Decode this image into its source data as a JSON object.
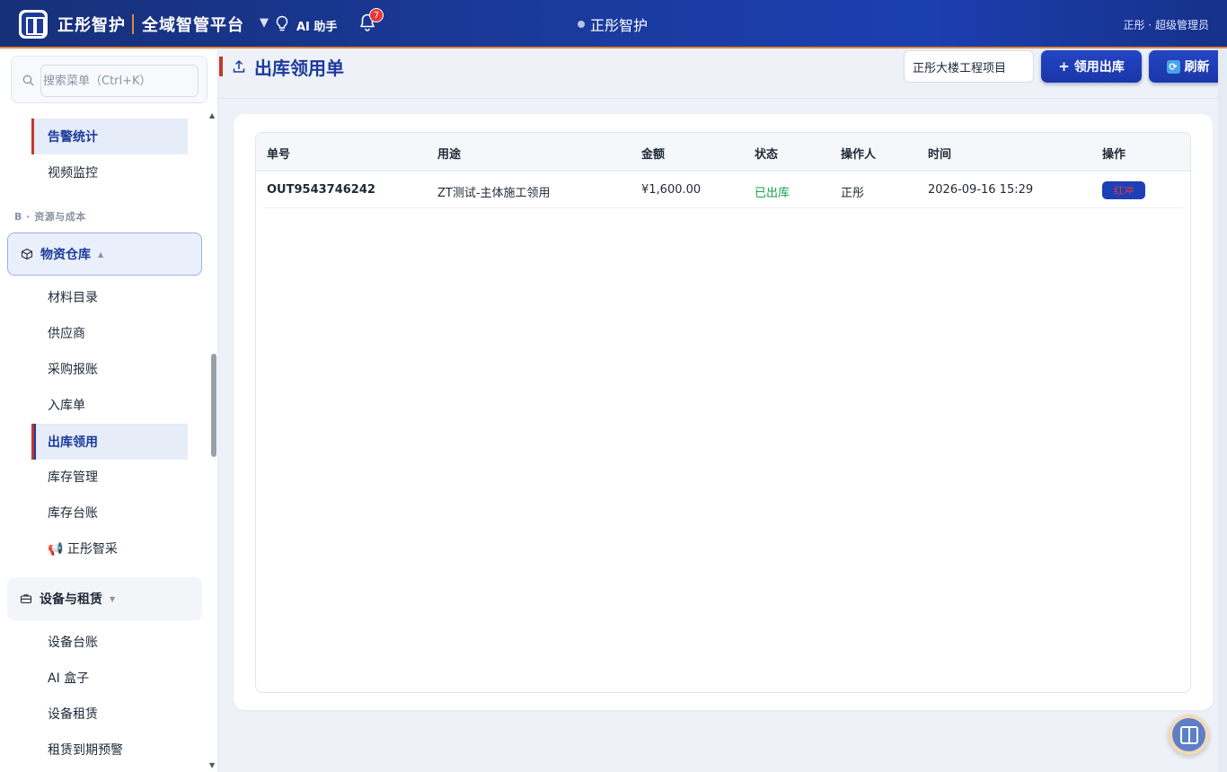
{
  "header": {
    "brand": "正彤智护",
    "platform": "全域智管平台",
    "ai_label": "AI 助手",
    "notification_count": "7",
    "center_title": "正彤智护",
    "user": "正彤 · 超级管理员"
  },
  "sidebar": {
    "search_placeholder": "搜索菜单（Ctrl+K）",
    "items_top": [
      {
        "label": "告警统计",
        "active": true
      },
      {
        "label": "视频监控",
        "active": false
      }
    ],
    "section_label": "B · 资源与成本",
    "group_warehouse": {
      "label": "物资仓库",
      "caret": "▲"
    },
    "warehouse_items": [
      {
        "label": "材料目录"
      },
      {
        "label": "供应商"
      },
      {
        "label": "采购报账"
      },
      {
        "label": "入库单"
      },
      {
        "label": "出库领用",
        "active": true
      },
      {
        "label": "库存管理"
      },
      {
        "label": "库存台账"
      },
      {
        "label": "📢 正彤智采"
      }
    ],
    "group_equipment": {
      "label": "设备与租赁",
      "caret": "▼"
    },
    "equipment_items": [
      {
        "label": "设备台账"
      },
      {
        "label": "AI 盒子"
      },
      {
        "label": "设备租赁"
      },
      {
        "label": "租赁到期预警"
      }
    ]
  },
  "page": {
    "title": "出库领用单",
    "project": "正彤大楼工程项目",
    "add_button": "领用出库",
    "refresh_button": "刷新"
  },
  "table": {
    "columns": [
      "单号",
      "用途",
      "金额",
      "状态",
      "操作人",
      "时间",
      "操作"
    ],
    "rows": [
      {
        "id": "OUT9543746242",
        "purpose": "ZT测试-主体施工领用",
        "amount": "¥1,600.00",
        "status": "已出库",
        "operator": "正彤",
        "time": "2026-09-16 15:29",
        "action": "红冲"
      }
    ]
  },
  "colors": {
    "primary": "#1b3a9c",
    "accent": "#c0392b",
    "success": "#16a34a",
    "danger": "#e53935"
  }
}
